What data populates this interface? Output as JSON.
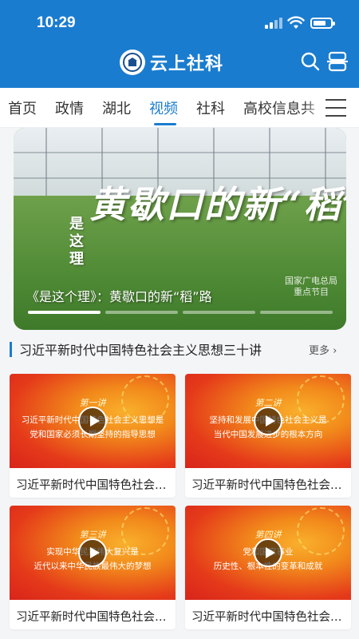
{
  "status_bar": {
    "time": "10:29",
    "battery_level": 0.75
  },
  "header": {
    "title": "云上社科",
    "icons": [
      "logo-icon",
      "search-icon",
      "scan-icon"
    ]
  },
  "tabs": {
    "items": [
      {
        "label": "首页",
        "active": false
      },
      {
        "label": "政情",
        "active": false
      },
      {
        "label": "湖北",
        "active": false
      },
      {
        "label": "视频",
        "active": true
      },
      {
        "label": "社科",
        "active": false
      },
      {
        "label": "高校信息共",
        "active": false
      }
    ],
    "menu_icon": "hamburger-menu-icon"
  },
  "banner": {
    "headline": "黄歇口的新“稻”路",
    "seal_text": [
      "是",
      "这",
      "理"
    ],
    "caption": "《是这个理》：黄歇口的新“稻”路",
    "watermark": [
      "国家广电总局",
      "重点节目"
    ],
    "slide_count": 4,
    "active_slide": 0
  },
  "section": {
    "title": "习近平新时代中国特色社会主义思想三十讲",
    "more_label": "更多"
  },
  "cards": [
    {
      "lecture": "第一讲",
      "lines": [
        "习近平新时代中国特色社会主义思想是",
        "党和国家必须长期坚持的指导思想"
      ],
      "title": "习近平新时代中国特色社会主义思想..."
    },
    {
      "lecture": "第二讲",
      "lines": [
        "坚持和发展中国特色社会主义是",
        "当代中国发展进步的根本方向"
      ],
      "title": "习近平新时代中国特色社会主义思想..."
    },
    {
      "lecture": "第三讲",
      "lines": [
        "实现中华民族伟大复兴是",
        "近代以来中华民族最伟大的梦想"
      ],
      "title": "习近平新时代中国特色社会主义思想..."
    },
    {
      "lecture": "第四讲",
      "lines": [
        "党和国家事业",
        "历史性、根本性的变革和成就"
      ],
      "title": "习近平新时代中国特色社会主义思想..."
    }
  ],
  "colors": {
    "primary": "#1a7ccf",
    "thumb_red": "#e53a1a",
    "thumb_orange": "#f9b02c"
  }
}
